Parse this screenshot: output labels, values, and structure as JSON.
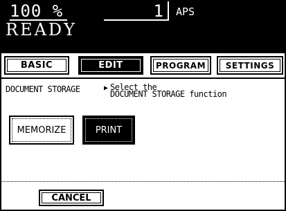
{
  "status": {
    "magnification": "100 %",
    "copies": "1",
    "paper_mode": "APS",
    "state": "READY"
  },
  "tabs": [
    {
      "label": "BASIC",
      "active": false
    },
    {
      "label": "EDIT",
      "active": true
    },
    {
      "label": "PROGRAM",
      "active": false
    },
    {
      "label": "SETTINGS",
      "active": false
    }
  ],
  "function": {
    "name": "DOCUMENT STORAGE",
    "instruction_line1": "Select the",
    "instruction_line2": "DOCUMENT STORAGE function"
  },
  "options": {
    "memorize_label": "MEMORIZE",
    "print_label": "PRINT",
    "selected": "PRINT"
  },
  "footer": {
    "cancel_label": "CANCEL"
  }
}
